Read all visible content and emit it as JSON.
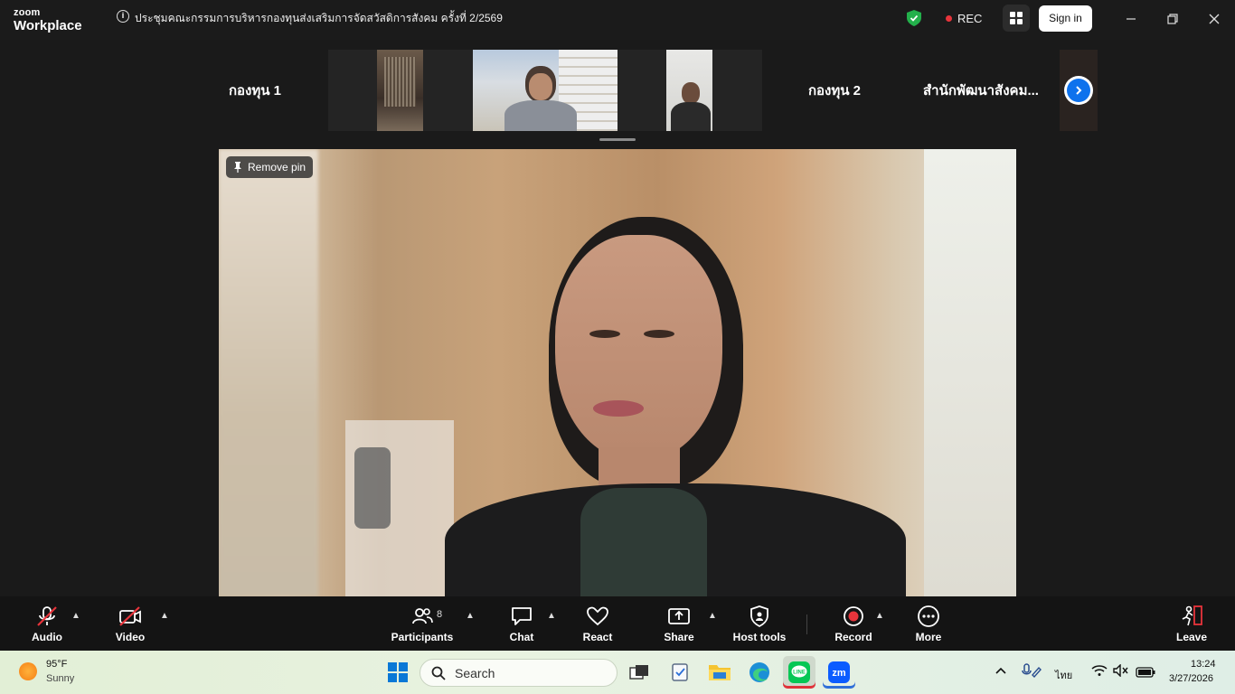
{
  "app": {
    "brand_small": "zoom",
    "brand_large": "Workplace"
  },
  "meeting": {
    "title": "ประชุมคณะกรรมการบริหารกองทุนส่งเสริมการจัดสวัสดิการสังคม ครั้งที่ 2/2569"
  },
  "status": {
    "rec_label": "REC",
    "signin_label": "Sign in"
  },
  "strip": {
    "tiles": [
      "กองทุน 1",
      "กองทุน 2",
      "สำนักพัฒนาสังคม..."
    ]
  },
  "pinned": {
    "remove_pin_label": "Remove pin"
  },
  "toolbar": {
    "audio": "Audio",
    "video": "Video",
    "participants": "Participants",
    "participants_count": "8",
    "chat": "Chat",
    "react": "React",
    "share": "Share",
    "host_tools": "Host tools",
    "record": "Record",
    "more": "More",
    "leave": "Leave"
  },
  "taskbar": {
    "temp": "95°F",
    "weather": "Sunny",
    "search_placeholder": "Search",
    "language": "ไทย",
    "time": "13:24",
    "date": "3/27/2026"
  },
  "colors": {
    "accent": "#0e72ed",
    "record_red": "#e8343b",
    "secure_green": "#23b04b"
  }
}
